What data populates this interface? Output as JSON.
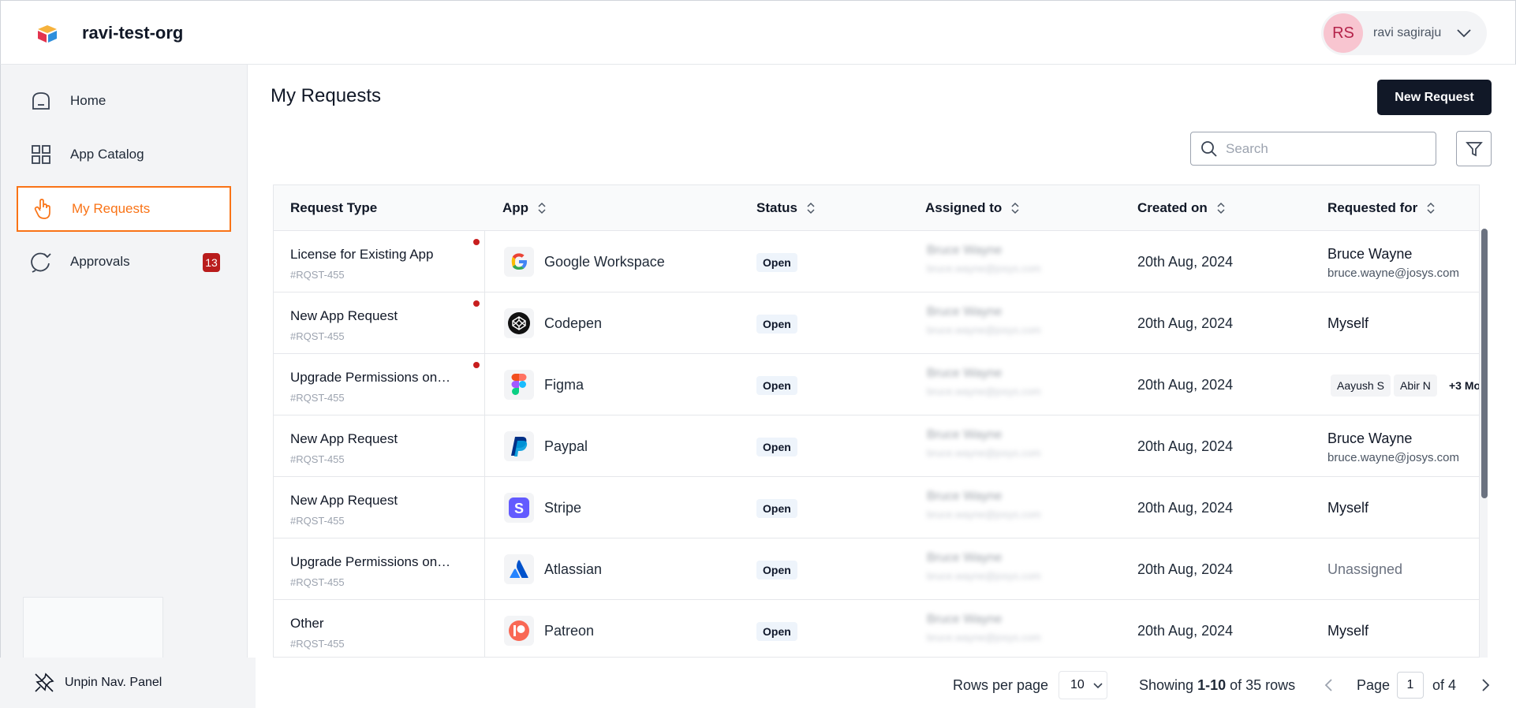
{
  "header": {
    "org_name": "ravi-test-org",
    "user_initials": "RS",
    "user_name": "ravi sagiraju"
  },
  "sidebar": {
    "items": [
      {
        "label": "Home",
        "icon": "home-icon"
      },
      {
        "label": "App Catalog",
        "icon": "grid-icon"
      },
      {
        "label": "My Requests",
        "icon": "hand-pointer-icon",
        "active": true
      },
      {
        "label": "Approvals",
        "icon": "approvals-icon",
        "badge": "13"
      }
    ],
    "unpin_label": "Unpin Nav. Panel"
  },
  "main": {
    "title": "My Requests",
    "new_request_label": "New Request",
    "search_placeholder": "Search"
  },
  "table": {
    "columns": [
      "Request Type",
      "App",
      "Status",
      "Assigned to",
      "Created on",
      "Requested for"
    ],
    "rows": [
      {
        "type": "License for Existing App",
        "id": "#RQST-455",
        "app": "Google Workspace",
        "app_icon": "google-icon",
        "status": "Open",
        "assigned_name": "Bruce Wayne",
        "assigned_email": "bruce.wayne@josys.com",
        "created": "20th Aug, 2024",
        "requested_name": "Bruce Wayne",
        "requested_email": "bruce.wayne@josys.com",
        "dot": true
      },
      {
        "type": "New App Request",
        "id": "#RQST-455",
        "app": "Codepen",
        "app_icon": "codepen-icon",
        "status": "Open",
        "assigned_name": "Bruce Wayne",
        "assigned_email": "bruce.wayne@josys.com",
        "created": "20th Aug, 2024",
        "requested_single": "Myself",
        "dot": true
      },
      {
        "type": "Upgrade Permissions on…",
        "id": "#RQST-455",
        "app": "Figma",
        "app_icon": "figma-icon",
        "status": "Open",
        "assigned_name": "Bruce Wayne",
        "assigned_email": "bruce.wayne@josys.com",
        "created": "20th Aug, 2024",
        "chips": [
          "Aayush S",
          "Abir N"
        ],
        "more": "+3 Mo",
        "dot": true
      },
      {
        "type": "New App Request",
        "id": "#RQST-455",
        "app": "Paypal",
        "app_icon": "paypal-icon",
        "status": "Open",
        "assigned_name": "Bruce Wayne",
        "assigned_email": "bruce.wayne@josys.com",
        "created": "20th Aug, 2024",
        "requested_name": "Bruce Wayne",
        "requested_email": "bruce.wayne@josys.com"
      },
      {
        "type": "New App Request",
        "id": "#RQST-455",
        "app": "Stripe",
        "app_icon": "stripe-icon",
        "status": "Open",
        "assigned_name": "Bruce Wayne",
        "assigned_email": "bruce.wayne@josys.com",
        "created": "20th Aug, 2024",
        "requested_single": "Myself"
      },
      {
        "type": "Upgrade Permissions on…",
        "id": "#RQST-455",
        "app": "Atlassian",
        "app_icon": "atlassian-icon",
        "status": "Open",
        "assigned_name": "Bruce Wayne",
        "assigned_email": "bruce.wayne@josys.com",
        "created": "20th Aug, 2024",
        "requested_single": "Unassigned",
        "muted": true
      },
      {
        "type": "Other",
        "id": "#RQST-455",
        "app": "Patreon",
        "app_icon": "patreon-icon",
        "status": "Open",
        "assigned_name": "Bruce Wayne",
        "assigned_email": "bruce.wayne@josys.com",
        "created": "20th Aug, 2024",
        "requested_single": "Myself"
      }
    ]
  },
  "footer": {
    "rows_per_page_label": "Rows per page",
    "rows_per_page": "10",
    "showing_prefix": "Showing ",
    "showing_range": "1-10",
    "showing_suffix": " of 35 rows",
    "page_label": "Page",
    "page_value": "1",
    "page_of": "of 4"
  },
  "colors": {
    "accent": "#f97316",
    "primary_button": "#111827",
    "badge": "#b91c1c"
  }
}
